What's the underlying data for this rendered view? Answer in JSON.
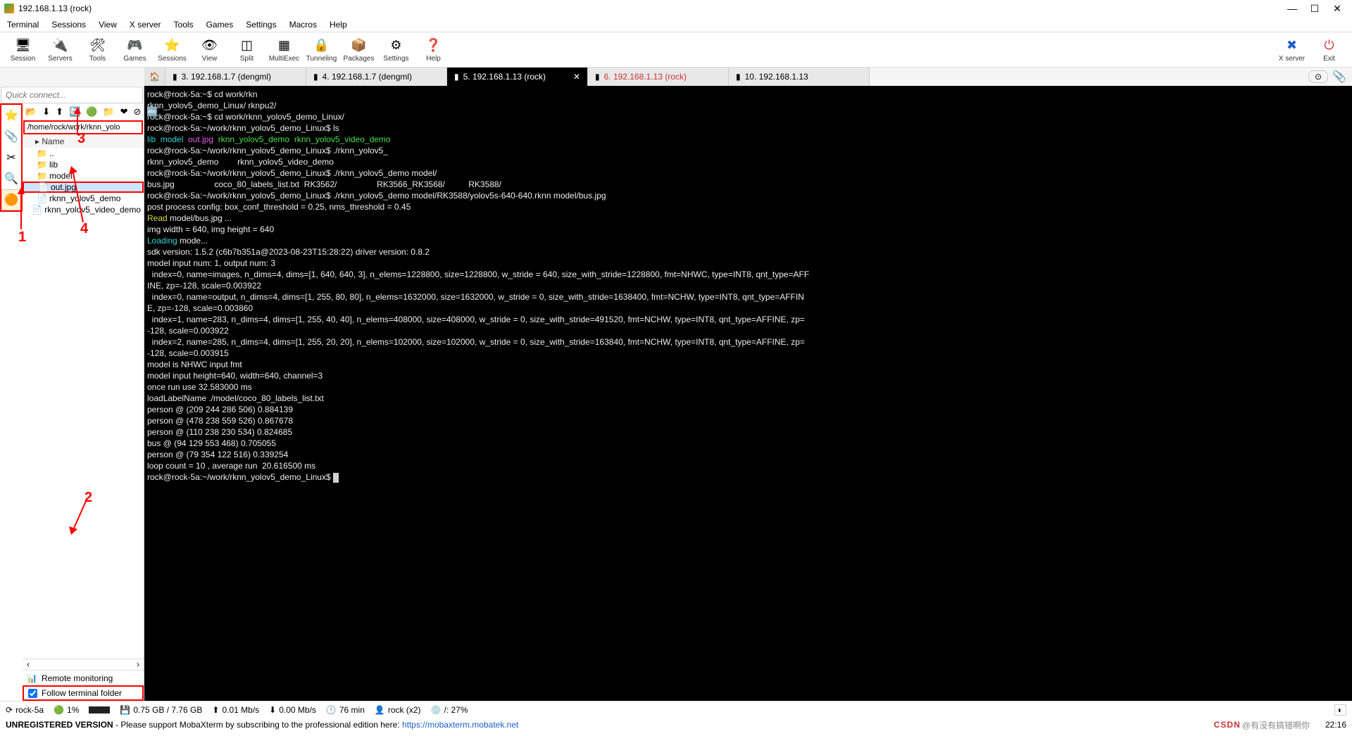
{
  "title": "192.168.1.13 (rock)",
  "window_controls": {
    "min": "—",
    "max": "☐",
    "close": "✕"
  },
  "menu": [
    "Terminal",
    "Sessions",
    "View",
    "X server",
    "Tools",
    "Games",
    "Settings",
    "Macros",
    "Help"
  ],
  "tools": [
    {
      "icon": "🖥",
      "label": "Session"
    },
    {
      "icon": "🔌",
      "label": "Servers"
    },
    {
      "icon": "🛠",
      "label": "Tools"
    },
    {
      "icon": "🎮",
      "label": "Games"
    },
    {
      "icon": "⭐",
      "label": "Sessions"
    },
    {
      "icon": "👁",
      "label": "View"
    },
    {
      "icon": "◫",
      "label": "Split"
    },
    {
      "icon": "▦",
      "label": "MultiExec"
    },
    {
      "icon": "🔒",
      "label": "Tunneling"
    },
    {
      "icon": "📦",
      "label": "Packages"
    },
    {
      "icon": "⚙",
      "label": "Settings"
    },
    {
      "icon": "❓",
      "label": "Help"
    }
  ],
  "tools_right": [
    {
      "icon": "✖",
      "label": "X server",
      "color": "#1a5fcc"
    },
    {
      "icon": "⏻",
      "label": "Exit",
      "color": "#c33"
    }
  ],
  "tabs": [
    {
      "num": "3.",
      "label": "192.168.1.7 (dengml)",
      "active": false
    },
    {
      "num": "4.",
      "label": "192.168.1.7 (dengml)",
      "active": false
    },
    {
      "num": "5.",
      "label": "192.168.1.13 (rock)",
      "active": true
    },
    {
      "num": "6.",
      "label": "192.168.1.13 (rock)",
      "active": false,
      "color": "#c33"
    },
    {
      "num": "10.",
      "label": "192.168.1.13",
      "active": false
    }
  ],
  "quickconnect_placeholder": "Quick connect...",
  "sidetabs": [
    "⭐",
    "📎",
    "✂",
    "🔍",
    "🟠"
  ],
  "file_toolbar_icons": [
    "📂",
    "⬇",
    "⬆",
    "🔄",
    "🟢",
    "📁",
    "❤",
    "⊘",
    "🔤"
  ],
  "path": "/home/rock/work/rknn_yolo",
  "tree_header": "Name",
  "tree": [
    {
      "indent": 0,
      "icon": "folder",
      "name": ".."
    },
    {
      "indent": 0,
      "icon": "folder",
      "name": "lib"
    },
    {
      "indent": 0,
      "icon": "folder",
      "name": "model"
    },
    {
      "indent": 0,
      "icon": "file",
      "name": "out.jpg",
      "sel": true
    },
    {
      "indent": 0,
      "icon": "file",
      "name": "rknn_yolov5_demo"
    },
    {
      "indent": 0,
      "icon": "file",
      "name": "rknn_yolov5_video_demo"
    }
  ],
  "remote_monitoring": "Remote monitoring",
  "follow_terminal": "Follow terminal folder",
  "terminal_lines": [
    {
      "segs": [
        {
          "c": "white",
          "t": "rock@rock-5a:~$ cd work/rkn"
        }
      ]
    },
    {
      "segs": [
        {
          "c": "white",
          "t": "rknn_yolov5_demo_Linux/ rknpu2/"
        }
      ]
    },
    {
      "segs": [
        {
          "c": "white",
          "t": "rock@rock-5a:~$ cd work/rknn_yolov5_demo_Linux/"
        }
      ]
    },
    {
      "segs": [
        {
          "c": "white",
          "t": "rock@rock-5a:~/work/rknn_yolov5_demo_Linux$ ls"
        }
      ]
    },
    {
      "segs": [
        {
          "c": "cyan",
          "t": "lib"
        },
        {
          "c": "",
          "t": "  "
        },
        {
          "c": "cyan",
          "t": "model"
        },
        {
          "c": "",
          "t": "  "
        },
        {
          "c": "magenta",
          "t": "out.jpg"
        },
        {
          "c": "",
          "t": "  "
        },
        {
          "c": "green",
          "t": "rknn_yolov5_demo"
        },
        {
          "c": "",
          "t": "  "
        },
        {
          "c": "green",
          "t": "rknn_yolov5_video_demo"
        }
      ]
    },
    {
      "segs": [
        {
          "c": "white",
          "t": "rock@rock-5a:~/work/rknn_yolov5_demo_Linux$ ./rknn_yolov5_"
        }
      ]
    },
    {
      "segs": [
        {
          "c": "white",
          "t": "rknn_yolov5_demo        rknn_yolov5_video_demo"
        }
      ]
    },
    {
      "segs": [
        {
          "c": "white",
          "t": "rock@rock-5a:~/work/rknn_yolov5_demo_Linux$ ./rknn_yolov5_demo model/"
        }
      ]
    },
    {
      "segs": [
        {
          "c": "white",
          "t": "bus.jpg                 coco_80_labels_list.txt  RK3562/                 RK3566_RK3568/          RK3588/"
        }
      ]
    },
    {
      "segs": [
        {
          "c": "white",
          "t": "rock@rock-5a:~/work/rknn_yolov5_demo_Linux$ ./rknn_yolov5_demo model/RK3588/yolov5s-640-640.rknn model/bus.jpg"
        }
      ]
    },
    {
      "segs": [
        {
          "c": "white",
          "t": "post process config: box_conf_threshold = 0.25, nms_threshold = 0.45"
        }
      ]
    },
    {
      "segs": [
        {
          "c": "yellow",
          "t": "Read"
        },
        {
          "c": "white",
          "t": " model/bus.jpg ..."
        }
      ]
    },
    {
      "segs": [
        {
          "c": "white",
          "t": "img width = 640, img height = 640"
        }
      ]
    },
    {
      "segs": [
        {
          "c": "cyan",
          "t": "Loading"
        },
        {
          "c": "white",
          "t": " mode..."
        }
      ]
    },
    {
      "segs": [
        {
          "c": "white",
          "t": "sdk version: 1.5.2 (c6b7b351a@2023-08-23T15:28:22) driver version: 0.8.2"
        }
      ]
    },
    {
      "segs": [
        {
          "c": "white",
          "t": "model input num: 1, output num: 3"
        }
      ]
    },
    {
      "segs": [
        {
          "c": "white",
          "t": "  index=0, name=images, n_dims=4, dims=[1, 640, 640, 3], n_elems=1228800, size=1228800, w_stride = 640, size_with_stride=1228800, fmt=NHWC, type=INT8, qnt_type=AFF"
        }
      ]
    },
    {
      "segs": [
        {
          "c": "white",
          "t": "INE, zp=-128, scale=0.003922"
        }
      ]
    },
    {
      "segs": [
        {
          "c": "white",
          "t": "  index=0, name=output, n_dims=4, dims=[1, 255, 80, 80], n_elems=1632000, size=1632000, w_stride = 0, size_with_stride=1638400, fmt=NCHW, type=INT8, qnt_type=AFFIN"
        }
      ]
    },
    {
      "segs": [
        {
          "c": "white",
          "t": "E, zp=-128, scale=0.003860"
        }
      ]
    },
    {
      "segs": [
        {
          "c": "white",
          "t": "  index=1, name=283, n_dims=4, dims=[1, 255, 40, 40], n_elems=408000, size=408000, w_stride = 0, size_with_stride=491520, fmt=NCHW, type=INT8, qnt_type=AFFINE, zp="
        }
      ]
    },
    {
      "segs": [
        {
          "c": "white",
          "t": "-128, scale=0.003922"
        }
      ]
    },
    {
      "segs": [
        {
          "c": "white",
          "t": "  index=2, name=285, n_dims=4, dims=[1, 255, 20, 20], n_elems=102000, size=102000, w_stride = 0, size_with_stride=163840, fmt=NCHW, type=INT8, qnt_type=AFFINE, zp="
        }
      ]
    },
    {
      "segs": [
        {
          "c": "white",
          "t": "-128, scale=0.003915"
        }
      ]
    },
    {
      "segs": [
        {
          "c": "white",
          "t": "model is NHWC input fmt"
        }
      ]
    },
    {
      "segs": [
        {
          "c": "white",
          "t": "model input height=640, width=640, channel=3"
        }
      ]
    },
    {
      "segs": [
        {
          "c": "white",
          "t": "once run use 32.583000 ms"
        }
      ]
    },
    {
      "segs": [
        {
          "c": "white",
          "t": "loadLabelName ./model/coco_80_labels_list.txt"
        }
      ]
    },
    {
      "segs": [
        {
          "c": "white",
          "t": "person @ (209 244 286 506) 0.884139"
        }
      ]
    },
    {
      "segs": [
        {
          "c": "white",
          "t": "person @ (478 238 559 526) 0.867678"
        }
      ]
    },
    {
      "segs": [
        {
          "c": "white",
          "t": "person @ (110 238 230 534) 0.824685"
        }
      ]
    },
    {
      "segs": [
        {
          "c": "white",
          "t": "bus @ (94 129 553 468) 0.705055"
        }
      ]
    },
    {
      "segs": [
        {
          "c": "white",
          "t": "person @ (79 354 122 516) 0.339254"
        }
      ]
    },
    {
      "segs": [
        {
          "c": "white",
          "t": "loop count = 10 , average run  20.616500 ms"
        }
      ]
    },
    {
      "segs": [
        {
          "c": "white",
          "t": "rock@rock-5a:~/work/rknn_yolov5_demo_Linux$ "
        },
        {
          "c": "cursor",
          "t": " "
        }
      ]
    }
  ],
  "status": {
    "host": "rock-5a",
    "cpu": "1%",
    "mem": "0.75 GB / 7.76 GB",
    "up": "0.01 Mb/s",
    "down": "0.00 Mb/s",
    "uptime": "76 min",
    "user": "rock (x2)",
    "disk": "/: 27%"
  },
  "footer_left": "UNREGISTERED VERSION",
  "footer_mid": "  -  Please support MobaXterm by subscribing to the professional edition here:  ",
  "footer_link": "https://mobaxterm.mobatek.net",
  "footer_right_a": "CSDN",
  "footer_right_b": "@有没有搞错啊你",
  "footer_time": "22:16",
  "annotations": {
    "a1": "1",
    "a2": "2",
    "a3": "3",
    "a4": "4"
  }
}
